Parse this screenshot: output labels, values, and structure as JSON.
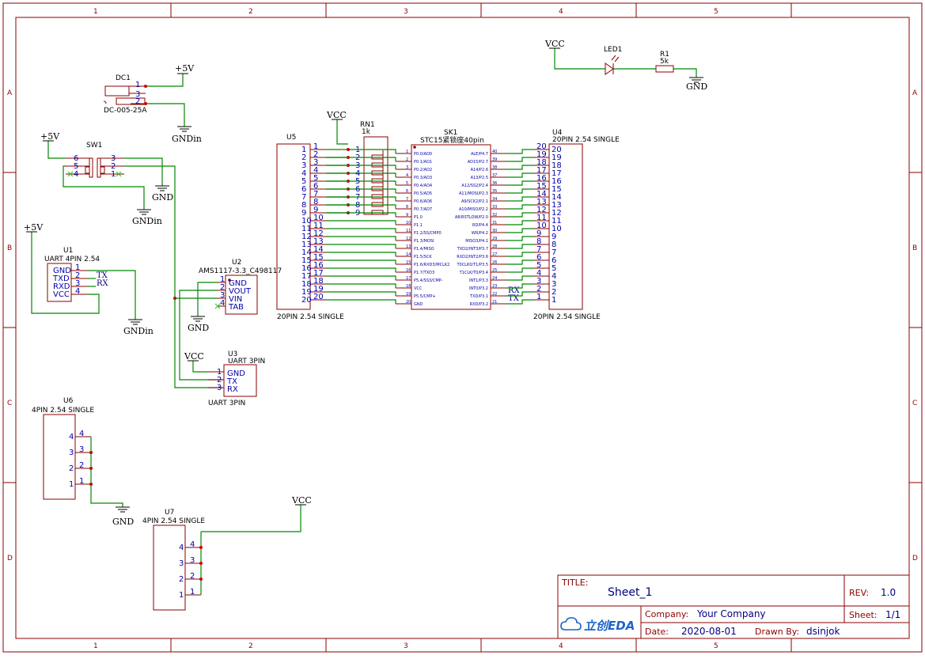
{
  "frame": {
    "col_labels": [
      "1",
      "2",
      "3",
      "4",
      "5"
    ],
    "row_labels": [
      "A",
      "B",
      "C",
      "D"
    ]
  },
  "title_block": {
    "title_label": "TITLE:",
    "title": "Sheet_1",
    "rev_label": "REV:",
    "rev": "1.0",
    "company_label": "Company:",
    "company": "Your Company",
    "sheet_label": "Sheet:",
    "sheet": "1/1",
    "date_label": "Date:",
    "date": "2020-08-01",
    "drawn_label": "Drawn By:",
    "drawn": "dsinjok",
    "logo": "立创EDA"
  },
  "components": {
    "dc1": {
      "ref": "DC1",
      "value": "DC-005-25A",
      "pins": [
        "1",
        "3",
        "2"
      ]
    },
    "sw1": {
      "ref": "SW1",
      "pins_left": [
        "6",
        "5",
        "4"
      ],
      "pins_right": [
        "3",
        "2",
        "1"
      ]
    },
    "u1": {
      "ref": "U1",
      "value": "UART 4PIN 2.54",
      "pin_names": [
        "GND",
        "TXD",
        "RXD",
        "VCC"
      ],
      "pin_nums": [
        "1",
        "2",
        "3",
        "4"
      ]
    },
    "u2": {
      "ref": "U2",
      "value": "AMS1117-3.3_C498117",
      "pin_names": [
        "GND",
        "VOUT",
        "VIN",
        "TAB"
      ],
      "pin_nums": [
        "1",
        "2",
        "3",
        "4"
      ]
    },
    "u3": {
      "ref": "U3",
      "value": "UART 3PIN",
      "value2": "UART 3PIN",
      "pin_names": [
        "GND",
        "TX",
        "RX"
      ],
      "pin_nums": [
        "1",
        "2",
        "3"
      ]
    },
    "u5": {
      "ref": "U5",
      "value": "20PIN 2.54 SINGLE",
      "pins": [
        "1",
        "2",
        "3",
        "4",
        "5",
        "6",
        "7",
        "8",
        "9",
        "10",
        "11",
        "12",
        "13",
        "14",
        "15",
        "16",
        "17",
        "18",
        "19",
        "20"
      ]
    },
    "u4": {
      "ref": "U4",
      "value": "20PIN 2.54 SINGLE",
      "value2": "20PIN 2.54 SINGLE",
      "pins": [
        "20",
        "19",
        "18",
        "17",
        "16",
        "15",
        "14",
        "13",
        "12",
        "11",
        "10",
        "9",
        "8",
        "7",
        "6",
        "5",
        "4",
        "3",
        "2",
        "1"
      ]
    },
    "rn1": {
      "ref": "RN1",
      "value": "1k",
      "pins": [
        "1",
        "2",
        "3",
        "4",
        "5",
        "6",
        "7",
        "8",
        "9"
      ]
    },
    "sk1": {
      "ref": "SK1",
      "value": "STC15紧锁座40pin",
      "left_pins": [
        "P0.0/AD0",
        "P0.1/AD1",
        "P0.2/AD2",
        "P0.3/AD3",
        "P0.4/AD4",
        "P0.5/AD5",
        "P0.6/AD6",
        "P0.7/AD7",
        "P1.0",
        "P1.1",
        "P1.2/SS/CMP0",
        "P1.3/MOSI",
        "P1.4/MISO",
        "P1.5/SCK",
        "P1.6/RXD3/MCLK2",
        "P1.7/TXD3",
        "P5.4/SS3/CMP-",
        "VCC",
        "P5.5/CMP+",
        "GND"
      ],
      "right_pins": [
        "ALE/P4.7",
        "AD15/P2.7",
        "A14/P2.6",
        "A13/P2.5",
        "A12/SS2/P2.4",
        "A11/MOSI/P2.3",
        "A9/SCK2/P2.1",
        "A10/MISO/P2.2",
        "A8/RSTLOW/P2.0",
        "RD/P4.4",
        "WR/P4.2",
        "MISO3/P4.1",
        "TXD2/INT3/P3.7",
        "RXD2/INT2/P3.6",
        "T0CLK0/T1/P3.5",
        "T1CLK/T0/P3.4",
        "INT1/P3.3",
        "INT0/P3.2",
        "TXD/P3.1",
        "RXD/P3.2"
      ],
      "left_nums": [
        "1",
        "2",
        "3",
        "4",
        "5",
        "6",
        "7",
        "8",
        "9",
        "10",
        "11",
        "12",
        "13",
        "14",
        "15",
        "16",
        "17",
        "18",
        "19",
        "20"
      ],
      "right_nums": [
        "40",
        "39",
        "38",
        "37",
        "36",
        "35",
        "34",
        "33",
        "32",
        "31",
        "30",
        "29",
        "28",
        "27",
        "26",
        "25",
        "24",
        "23",
        "22",
        "21"
      ]
    },
    "u6": {
      "ref": "U6",
      "value": "4PIN 2.54 SINGLE",
      "pins": [
        "4",
        "3",
        "2",
        "1"
      ]
    },
    "u7": {
      "ref": "U7",
      "value": "4PIN 2.54 SINGLE",
      "pins": [
        "4",
        "3",
        "2",
        "1"
      ]
    },
    "led1": {
      "ref": "LED1"
    },
    "r1": {
      "ref": "R1",
      "value": "5k"
    }
  },
  "nets": {
    "p5v": "+5V",
    "vcc": "VCC",
    "gnd": "GND",
    "gndin": "GNDin",
    "tx": "TX",
    "rx": "RX"
  }
}
